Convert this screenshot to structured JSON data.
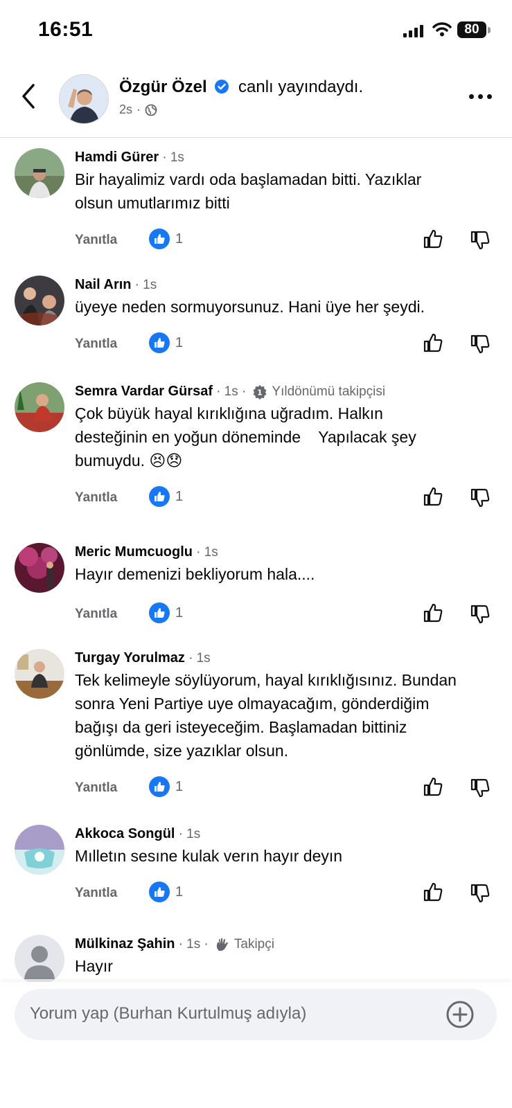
{
  "status_bar": {
    "time": "16:51",
    "battery": "80"
  },
  "header": {
    "author": "Özgür Özel",
    "action": "canlı yayındaydı.",
    "time": "2s",
    "privacy_icon": "globe-icon"
  },
  "comments": [
    {
      "name": "Hamdi Gürer",
      "time": "1s",
      "badge": "",
      "lines": [
        "Bir hayalimiz vardı oda başlamadan bitti. Yazıklar",
        "olsun umutlarımız bitti"
      ],
      "reply": "Yanıtla",
      "likes": "1"
    },
    {
      "name": "Nail Arın",
      "time": "1s",
      "badge": "",
      "lines": [
        "üyeye neden sormuyorsunuz. Hani üye her şeydi."
      ],
      "reply": "Yanıtla",
      "likes": "1"
    },
    {
      "name": "Semra Vardar Gürsaf",
      "time": "1s",
      "badge": "Yıldönümü takipçisi",
      "lines": [
        "Çok büyük hayal kırıklığına uğradım. Halkın",
        "desteğinin en yoğun döneminde    Yapılacak şey",
        "bumuydu. 😣😞"
      ],
      "reply": "Yanıtla",
      "likes": "1"
    },
    {
      "name": "Meric Mumcuoglu",
      "time": "1s",
      "badge": "",
      "lines": [
        "Hayır demenizi bekliyorum hala...."
      ],
      "reply": "Yanıtla",
      "likes": "1"
    },
    {
      "name": "Turgay Yorulmaz",
      "time": "1s",
      "badge": "",
      "lines": [
        "Tek kelimeyle söylüyorum, hayal kırıklığısınız. Bundan",
        "sonra Yeni Partiye uye olmayacağım, gönderdiğim",
        "bağışı da geri isteyeceğim. Başlamadan bittiniz",
        "gönlümde, size yazıklar olsun."
      ],
      "reply": "Yanıtla",
      "likes": "1"
    },
    {
      "name": "Akkoca Songül",
      "time": "1s",
      "badge": "",
      "lines": [
        "Mılletın sesıne kulak verın hayır deyın"
      ],
      "reply": "Yanıtla",
      "likes": "1"
    },
    {
      "name": "Mülkinaz Şahin",
      "time": "1s",
      "badge": "Takipçi",
      "lines": [
        "Hayır"
      ],
      "reply": "",
      "likes": ""
    }
  ],
  "composer": {
    "placeholder": "Yorum yap (Burhan Kurtulmuş adıyla)"
  },
  "colors": {
    "accent": "#1877f2",
    "secondary_text": "#65676b",
    "composer_bg": "#f0f2f5"
  }
}
